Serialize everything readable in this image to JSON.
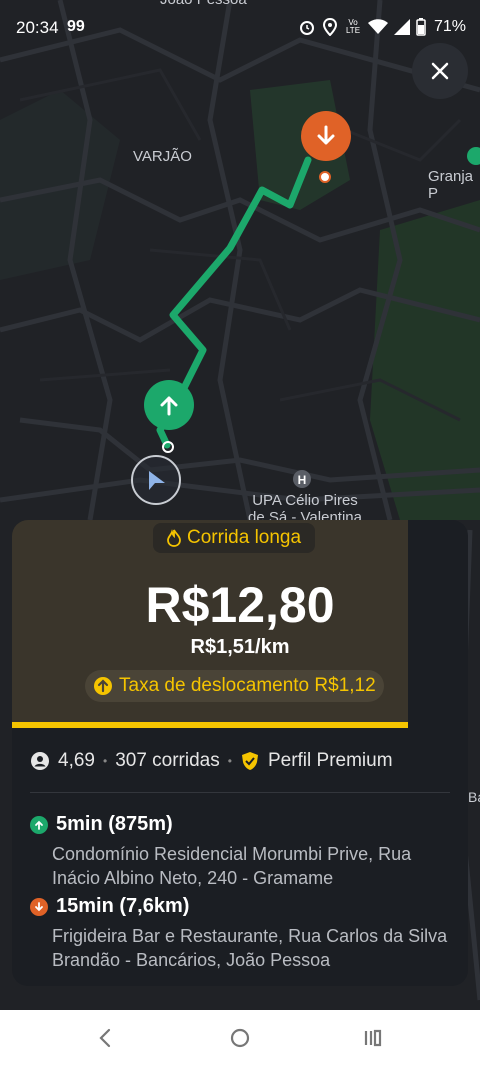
{
  "status_bar": {
    "time": "20:34",
    "notification": "99",
    "lte_label": "Vo LTE",
    "battery": "71%"
  },
  "map": {
    "labels": {
      "city_top": "João Pessoa",
      "varjao": "VARJÃO",
      "granja": "Granja P",
      "upa_line1": "UPA Célio Pires",
      "upa_line2": "de Sá - Valentina",
      "edge_label": "Ba"
    }
  },
  "ride_card": {
    "badge": "Corrida longa",
    "price": "R$12,80",
    "per_km": "R$1,51/km",
    "travel_fee": "Taxa de deslocamento R$1,12",
    "rating": "4,69",
    "rides": "307 corridas",
    "premium": "Perfil Premium",
    "pickup": {
      "eta": "5min (875m)",
      "address": "Condomínio Residencial Morumbi Prive, Rua Inácio Albino Neto, 240 - Gramame"
    },
    "dropoff": {
      "eta": "15min (7,6km)",
      "address": "Frigideira Bar e Restaurante, Rua Carlos da Silva Brandão - Bancários, João Pessoa"
    }
  },
  "colors": {
    "accent_yellow": "#f5c400",
    "route_green": "#1ca86b",
    "dest_orange": "#e06227"
  },
  "icons": [
    "close-icon",
    "flame-icon",
    "arrow-up-icon",
    "arrow-down-icon",
    "navigation-arrow-icon",
    "user-icon",
    "premium-shield-icon",
    "hospital-icon",
    "back-icon",
    "home-icon",
    "recents-icon"
  ]
}
